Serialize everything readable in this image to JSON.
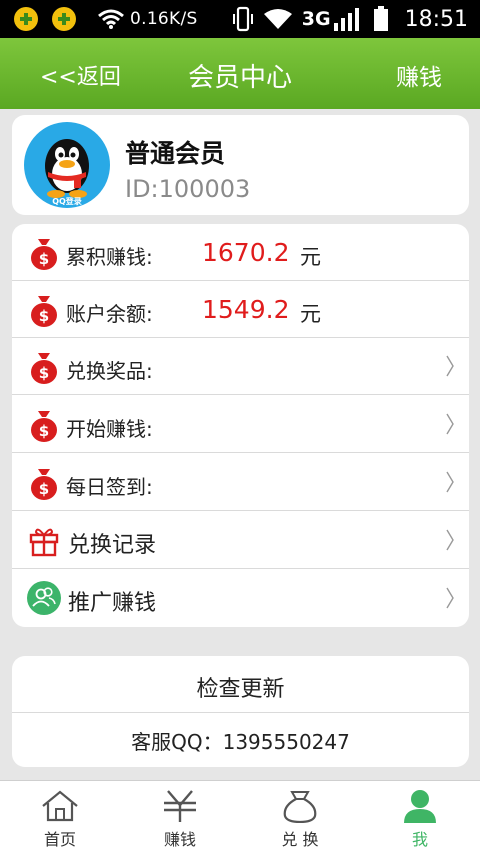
{
  "status_bar": {
    "speed": "0.16K/S",
    "network": "3G",
    "time": "18:51"
  },
  "header": {
    "back_label": "<<返回",
    "title": "会员中心",
    "right_label": "赚钱"
  },
  "profile": {
    "avatar_caption": "QQ登录",
    "name": "普通会员",
    "id": "ID:100003"
  },
  "menu": {
    "total_earned": {
      "label": "累积赚钱:",
      "value": "1670.2",
      "unit": "元"
    },
    "balance": {
      "label": "账户余额:",
      "value": "1549.2",
      "unit": "元"
    },
    "items": [
      {
        "label": "兑换奖品:",
        "chevron": "〉"
      },
      {
        "label": "开始赚钱:",
        "chevron": "〉"
      },
      {
        "label": "每日签到:",
        "chevron": "〉"
      },
      {
        "label": "兑换记录",
        "chevron": "〉"
      },
      {
        "label": "推广赚钱",
        "chevron": "〉"
      }
    ]
  },
  "update": {
    "check_label": "检查更新",
    "service_qq": "客服QQ：1395550247"
  },
  "tabbar": {
    "tabs": [
      {
        "label": "首页",
        "icon": "home-icon"
      },
      {
        "label": "赚钱",
        "icon": "yen-icon"
      },
      {
        "label": "兑 换",
        "icon": "money-bag-icon"
      },
      {
        "label": "我",
        "icon": "person-icon"
      }
    ],
    "active_index": 3
  },
  "colors": {
    "header_green": "#6bb82c",
    "value_red": "#e01c1c",
    "active_tab": "#3fb565",
    "bag_red": "#d81e1e"
  }
}
